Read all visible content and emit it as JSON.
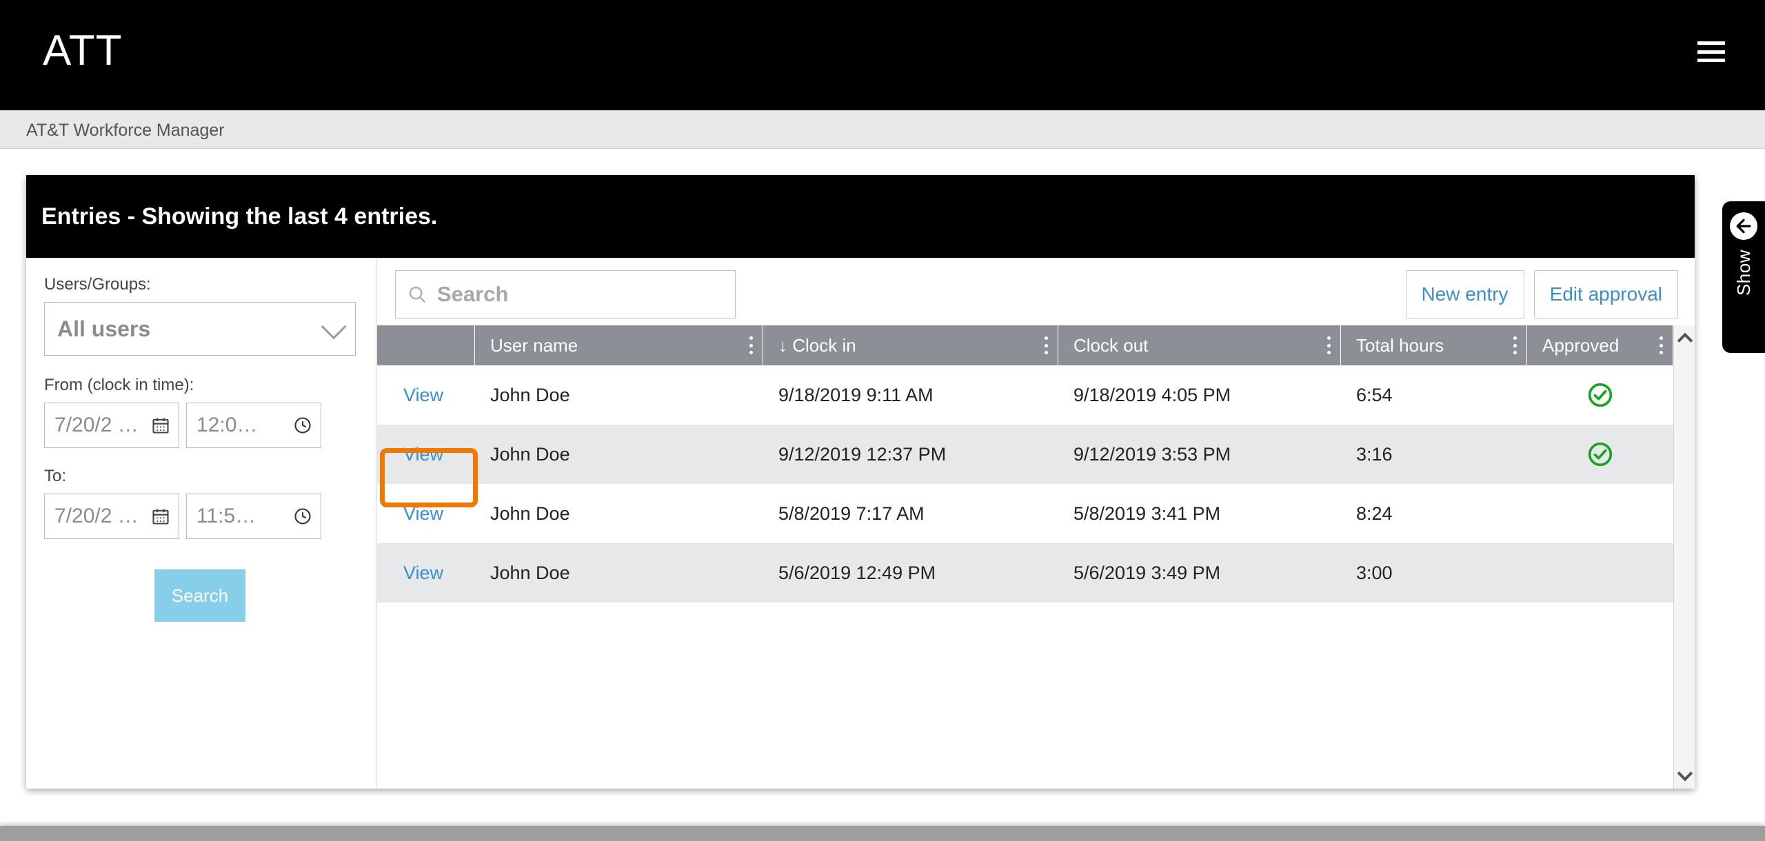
{
  "header": {
    "brand": "ATT",
    "menu_icon": "hamburger-icon",
    "sub_title": "AT&T Workforce Manager"
  },
  "card": {
    "title": "Entries - Showing the last 4 entries."
  },
  "filters": {
    "users_groups_label": "Users/Groups:",
    "users_groups_value": "All users",
    "from_label": "From (clock in time):",
    "from_date": "7/20/2 …",
    "from_time": "12:0…",
    "to_label": "To:",
    "to_date": "7/20/2 …",
    "to_time": "11:5…",
    "search_button": "Search"
  },
  "toolbar": {
    "search_placeholder": "Search",
    "search_value": "",
    "new_entry_label": "New entry",
    "edit_approval_label": "Edit approval"
  },
  "table": {
    "columns": [
      {
        "label": "",
        "key": "action"
      },
      {
        "label": "User name",
        "key": "user_name"
      },
      {
        "label": "↓ Clock in",
        "key": "clock_in"
      },
      {
        "label": "Clock out",
        "key": "clock_out"
      },
      {
        "label": "Total hours",
        "key": "total_hours"
      },
      {
        "label": "Approved",
        "key": "approved"
      }
    ],
    "sorted_column": "Clock in",
    "sort_direction": "descending",
    "rows": [
      {
        "action": "View",
        "user_name": "John Doe",
        "clock_in": "9/18/2019 9:11 AM",
        "clock_out": "9/18/2019 4:05 PM",
        "total_hours": "6:54",
        "approved": true
      },
      {
        "action": "View",
        "user_name": "John Doe",
        "clock_in": "9/12/2019 12:37 PM",
        "clock_out": "9/12/2019 3:53 PM",
        "total_hours": "3:16",
        "approved": true
      },
      {
        "action": "View",
        "user_name": "John Doe",
        "clock_in": "5/8/2019 7:17 AM",
        "clock_out": "5/8/2019 3:41 PM",
        "total_hours": "8:24",
        "approved": false
      },
      {
        "action": "View",
        "user_name": "John Doe",
        "clock_in": "5/6/2019 12:49 PM",
        "clock_out": "5/6/2019 3:49 PM",
        "total_hours": "3:00",
        "approved": false
      }
    ]
  },
  "side_tab": {
    "label": "Show",
    "icon": "arrow-left-circle-icon"
  },
  "highlight": {
    "target": "view-link-row-3",
    "color": "#f07800"
  },
  "colors": {
    "brand_black": "#000000",
    "accent_blue": "#3d8fc9",
    "search_button": "#87ceeb",
    "table_header": "#8c9096",
    "row_alt": "#e6e8ea",
    "approved_green": "#18a321",
    "highlight_orange": "#f07800"
  }
}
